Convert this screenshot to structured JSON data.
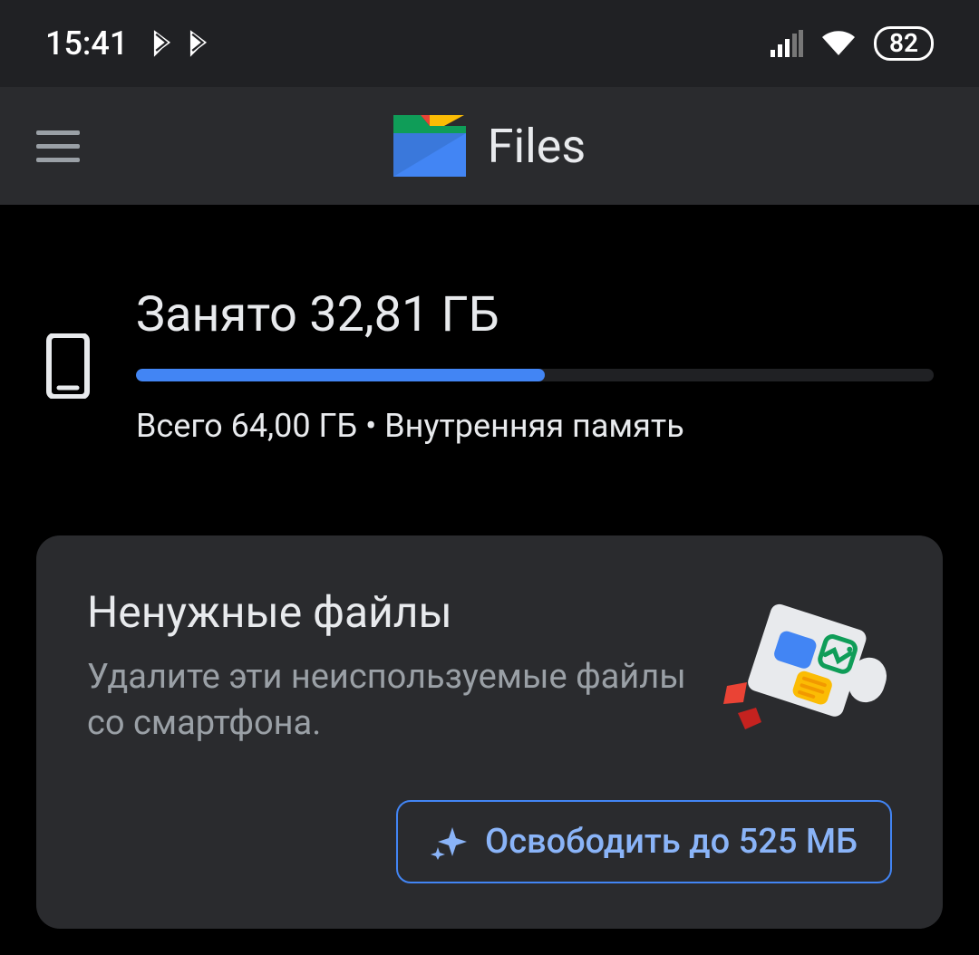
{
  "status": {
    "time": "15:41",
    "battery": "82"
  },
  "app": {
    "title": "Files"
  },
  "storage": {
    "used_label": "Занято 32,81 ГБ",
    "total_label": "Всего 64,00 ГБ • Внутренняя память",
    "percent": 51.3
  },
  "junk_card": {
    "title": "Ненужные файлы",
    "description": "Удалите эти неиспользуемые файлы со смартфона.",
    "button_label": "Освободить до 525 МБ"
  }
}
